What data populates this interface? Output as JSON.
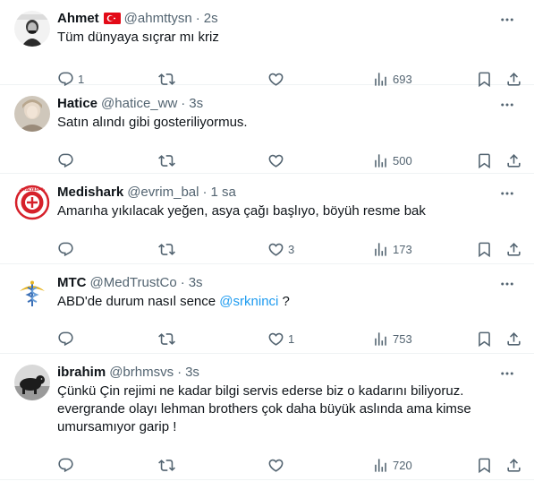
{
  "tweets": [
    {
      "name": "Ahmet",
      "handle": "@ahmttysn",
      "dot": "·",
      "time": "2s",
      "text": "Tüm dünyaya sıçrar mı kriz",
      "replies": "1",
      "retweets": "",
      "likes": "",
      "views": "693",
      "flag": "turkey-flag",
      "avatar_icon": "portrait-avatar"
    },
    {
      "name": "Hatice",
      "handle": "@hatice_ww",
      "dot": "·",
      "time": "3s",
      "text": "Satın alındı gibi gosteriliyormus.",
      "replies": "",
      "retweets": "",
      "likes": "",
      "views": "500",
      "avatar_icon": "portrait-avatar"
    },
    {
      "name": "Medishark",
      "handle": "@evrim_bal",
      "dot": "·",
      "time": "1 sa",
      "text": "Amarıha yıkılacak yeğen, asya çağı başlıyo, böyüh resme bak",
      "replies": "",
      "retweets": "",
      "likes": "3",
      "views": "173",
      "avatar_icon": "antalyaspor-logo",
      "avatar_text": "ANTALYASPOR"
    },
    {
      "name": "MTC",
      "handle": "@MedTrustCo",
      "dot": "·",
      "time": "3s",
      "text_before": "ABD'de durum nasıl sence ",
      "mention": "@srkninci",
      "text_after": " ?",
      "replies": "",
      "retweets": "",
      "likes": "1",
      "views": "753",
      "avatar_icon": "caduceus-logo"
    },
    {
      "name": "ibrahim",
      "handle": "@brhmsvs",
      "dot": "·",
      "time": "3s",
      "text": "Çünkü Çin rejimi ne kadar bilgi servis ederse biz o kadarını biliyoruz. evergrande olayı lehman brothers çok daha büyük aslında ama kimse umursamıyor garip !",
      "replies": "",
      "retweets": "",
      "likes": "",
      "views": "720",
      "avatar_icon": "animal-avatar"
    }
  ],
  "colors": {
    "text": "#0f1419",
    "secondary": "#536471",
    "link": "#1d9bf0",
    "divider": "#eff3f4"
  },
  "icons": {
    "reply": "reply-icon",
    "retweet": "retweet-icon",
    "like": "heart-icon",
    "views": "views-icon",
    "bookmark": "bookmark-icon",
    "share": "share-icon",
    "more": "more-icon"
  }
}
